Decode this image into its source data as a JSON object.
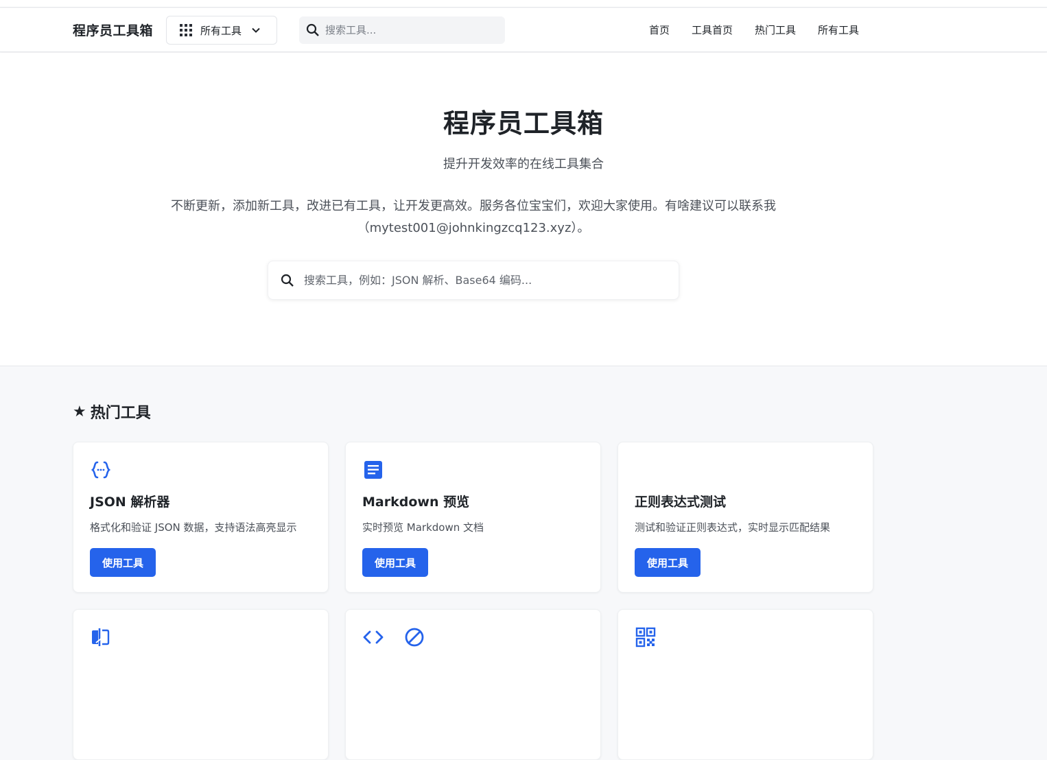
{
  "navbar": {
    "brand": "程序员工具箱",
    "all_tools_label": "所有工具",
    "search_placeholder": "搜索工具...",
    "links": [
      "首页",
      "工具首页",
      "热门工具",
      "所有工具"
    ]
  },
  "hero": {
    "title": "程序员工具箱",
    "subtitle": "提升开发效率的在线工具集合",
    "description": "不断更新，添加新工具，改进已有工具，让开发更高效。服务各位宝宝们，欢迎大家使用。有啥建议可以联系我（mytest001@johnkingzcq123.xyz）。",
    "search_placeholder": "搜索工具，例如：JSON 解析、Base64 编码..."
  },
  "popular": {
    "heading": "热门工具",
    "cards": [
      {
        "icon": "braces-icon",
        "title": "JSON 解析器",
        "desc": "格式化和验证 JSON 数据，支持语法高亮显示",
        "button": "使用工具"
      },
      {
        "icon": "document-icon",
        "title": "Markdown 预览",
        "desc": "实时预览 Markdown 文档",
        "button": "使用工具"
      },
      {
        "icon": "",
        "title": "正则表达式测试",
        "desc": "测试和验证正则表达式，实时显示匹配结果",
        "button": "使用工具"
      },
      {
        "icon": "compare-icon",
        "title": "",
        "desc": "",
        "button": ""
      },
      {
        "icon": "code-block-icon",
        "title": "",
        "desc": "",
        "button": ""
      },
      {
        "icon": "qr-code-icon",
        "title": "",
        "desc": "",
        "button": ""
      }
    ]
  },
  "colors": {
    "accent": "#2563eb",
    "text": "#1f2328",
    "muted": "#4b5058",
    "page_bg": "#f7f8fa"
  }
}
